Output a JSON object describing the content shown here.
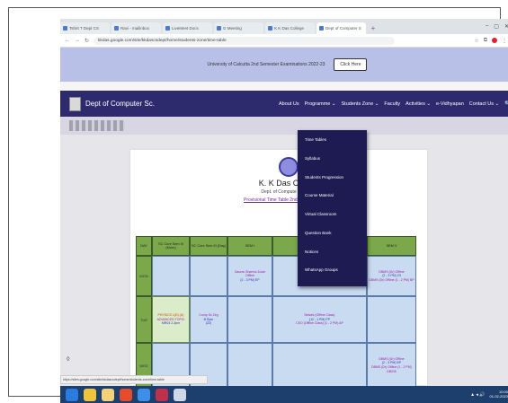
{
  "browser": {
    "tabs": [
      {
        "label": "Tshirt T Dept CS"
      },
      {
        "label": "Ravi - mailinbox"
      },
      {
        "label": "LiveMeet Docs"
      },
      {
        "label": "G Meeting"
      },
      {
        "label": "K K Das College"
      },
      {
        "label": "Dept of Computer S",
        "active": true
      }
    ],
    "new_tab": "+",
    "window_controls": [
      "–",
      "▢",
      "✕"
    ],
    "nav": {
      "back": "←",
      "forward": "→",
      "reload": "↻"
    },
    "url": "kkdas.google.com/site/kkdascsdept/home/students-zone/time-table"
  },
  "banner": {
    "text": "University of Calcutta 2nd Semester Examinations 2022-23",
    "button": "Click Here"
  },
  "navbar": {
    "dept_name": "Dept of Computer Sc.",
    "menu": [
      "About Us",
      "Programme ⌄",
      "Students Zone ⌄",
      "Faculty",
      "Activities ⌄",
      "e-Vidhyapan",
      "Contact Us ⌄",
      "🔍"
    ]
  },
  "dropdown": {
    "items": [
      "Time Tables",
      "Syllabus",
      "Students Progression",
      "Course Material",
      "Virtual Classroom",
      "Question Bank",
      "Notices",
      "WhatsApp Groups"
    ]
  },
  "page": {
    "college": "K. K Das C",
    "dept": "Dept. of Compute",
    "tt_link": "Provisional Time Table 2nd Semest"
  },
  "timetable": {
    "headers": [
      "DAY",
      "SC Core Sem III (Morn)",
      "SC Core Sem III (Day)",
      "SEM I",
      "",
      "SEM V"
    ],
    "rows": [
      {
        "day": "MON",
        "cells": [
          {
            "l1": "",
            "l2": "",
            "l3": ""
          },
          {
            "l1": "",
            "l2": "",
            "l3": ""
          },
          {
            "l1": "Gaurav Sharma Zoom",
            "l2": "Offline",
            "l3": "(2 - 3 PM) EP"
          },
          {
            "l1": "",
            "l2": "",
            "l3": ""
          },
          {
            "l1": "DBMS (Dr) Offline",
            "l2": "(2 - 3 PM) Z3",
            "l3": "DBMS (Dr) Offline (1 - 2 PM) BP"
          }
        ]
      },
      {
        "day": "TUE",
        "cells": [
          {
            "l1": "PHYSICS L(D) (U)",
            "l2": "ADVANCED TOPIC",
            "l3": "MR03 2-3pm"
          },
          {
            "l1": "Comp Sc Org",
            "l2": "B Rpm",
            "l3": "(Z2)"
          },
          {
            "l1": "",
            "l2": "",
            "l3": ""
          },
          {
            "l1": "Netwrk (Offline Class)",
            "l2": "(12 - 1 PM) PP",
            "l3": "CEO (Offline Class) (1 - 2 PM) AP"
          },
          {
            "l1": "",
            "l2": "",
            "l3": ""
          }
        ]
      },
      {
        "day": "WED",
        "cells": [
          {
            "l1": "",
            "l2": "",
            "l3": ""
          },
          {
            "l1": "",
            "l2": "",
            "l3": ""
          },
          {
            "l1": "",
            "l2": "",
            "l3": ""
          },
          {
            "l1": "",
            "l2": "",
            "l3": ""
          },
          {
            "l1": "DBMS (Dr) Offline",
            "l2": "(2 - 3 PM) BP",
            "l3": "DBMS (Dr) Offline (1 - 2 PM) GB/DE"
          }
        ]
      }
    ]
  },
  "status_url": "https://sites.google.com/site/kkdascsdept/home/students-zone/time-table",
  "taskbar": {
    "apps": [
      {
        "name": "start-icon",
        "color": "#2a7be0"
      },
      {
        "name": "explorer-icon",
        "color": "#f0c33c"
      },
      {
        "name": "folder-icon",
        "color": "#f5d27a"
      },
      {
        "name": "media-icon",
        "color": "#e84b2a"
      },
      {
        "name": "chrome-icon",
        "color": "#3d8ee8"
      },
      {
        "name": "pdf-icon",
        "color": "#c0304a"
      },
      {
        "name": "text-icon",
        "color": "#cfd8e4"
      }
    ],
    "tray": "▲ ◂ 🔊",
    "time": "10:00",
    "date": "01-02-2023"
  }
}
